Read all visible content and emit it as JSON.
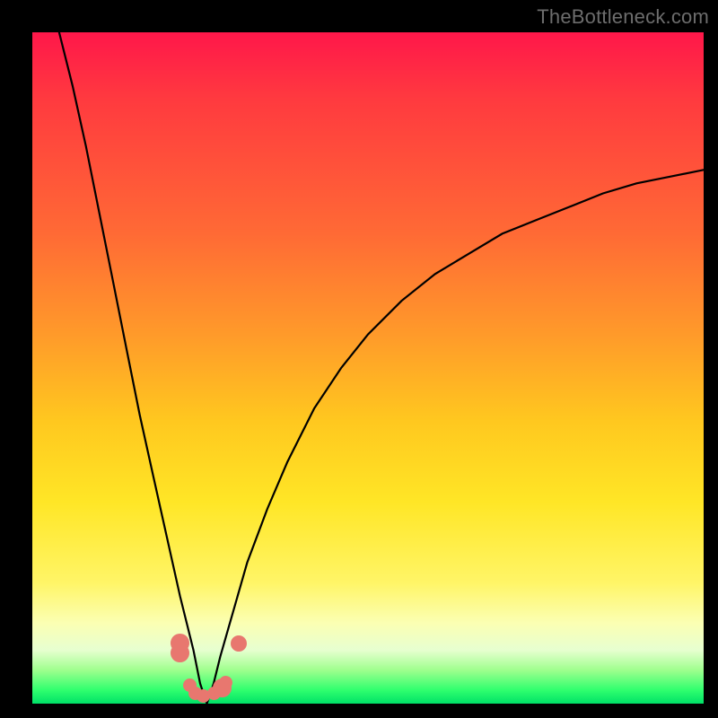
{
  "watermark": "TheBottleneck.com",
  "chart_data": {
    "type": "line",
    "title": "",
    "xlabel": "",
    "ylabel": "",
    "xlim": [
      0,
      100
    ],
    "ylim": [
      0,
      100
    ],
    "grid": false,
    "legend": false,
    "note": "Bottleneck-style V-curve. Axes are unlabeled; values are percent estimates read from pixel positions. x is horizontal (0 left → 100 right), y is vertical (0 bottom → 100 top). Minimum near x≈26.",
    "series": [
      {
        "name": "left-branch",
        "x": [
          4,
          6,
          8,
          10,
          12,
          14,
          16,
          18,
          20,
          22,
          24,
          25,
          26
        ],
        "y": [
          100,
          92,
          83,
          73,
          63,
          53,
          43,
          34,
          25,
          16,
          8,
          3,
          0
        ]
      },
      {
        "name": "right-branch",
        "x": [
          26,
          27,
          28,
          30,
          32,
          35,
          38,
          42,
          46,
          50,
          55,
          60,
          65,
          70,
          75,
          80,
          85,
          90,
          95,
          100
        ],
        "y": [
          0,
          3,
          7,
          14,
          21,
          29,
          36,
          44,
          50,
          55,
          60,
          64,
          67,
          70,
          72,
          74,
          76,
          77.5,
          78.5,
          79.5
        ]
      }
    ],
    "markers": [
      {
        "x": 22.0,
        "y": 9.0,
        "r": 1.4
      },
      {
        "x": 22.0,
        "y": 7.5,
        "r": 1.4
      },
      {
        "x": 23.5,
        "y": 2.7,
        "r": 1.0
      },
      {
        "x": 24.2,
        "y": 1.5,
        "r": 1.0
      },
      {
        "x": 25.5,
        "y": 1.2,
        "r": 1.0
      },
      {
        "x": 27.0,
        "y": 1.5,
        "r": 1.0
      },
      {
        "x": 28.3,
        "y": 2.3,
        "r": 1.4
      },
      {
        "x": 28.8,
        "y": 3.2,
        "r": 1.0
      },
      {
        "x": 30.7,
        "y": 9.0,
        "r": 1.2
      }
    ],
    "colors": {
      "curve": "#000000",
      "marker": "#e8776f",
      "gradient_top": "#ff174a",
      "gradient_bottom": "#00e067"
    }
  }
}
